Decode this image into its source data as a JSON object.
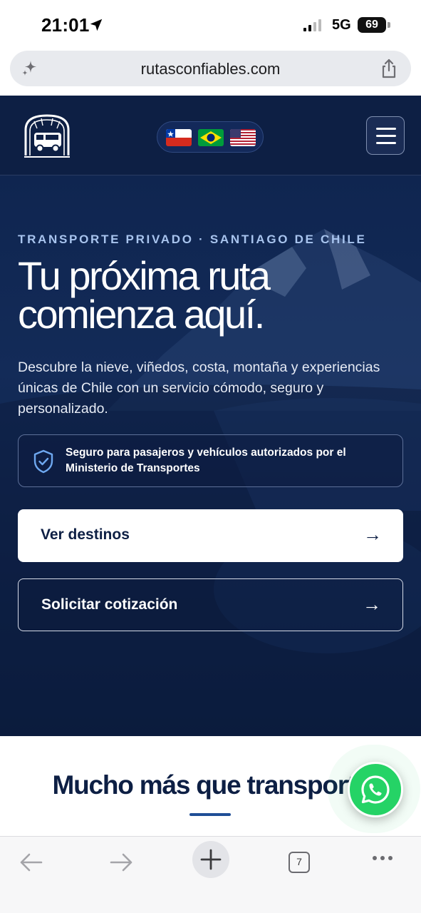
{
  "status_bar": {
    "time": "21:01",
    "network": "5G",
    "battery": "69"
  },
  "browser": {
    "url": "rutasconfiables.com",
    "tab_count": "7"
  },
  "header": {
    "languages": [
      "Español (Chile)",
      "Português (Brasil)",
      "English (USA)"
    ]
  },
  "hero": {
    "eyebrow": "TRANSPORTE PRIVADO · SANTIAGO DE CHILE",
    "headline_line1": "Tu próxima ruta",
    "headline_line2": "comienza aquí.",
    "intro": "Descubre la nieve, viñedos, costa, montaña y experiencias únicas de Chile con un servicio cómodo, seguro y personalizado.",
    "safety_notice": "Seguro para pasajeros y vehículos autorizados por el Ministerio de Transportes",
    "cta_primary": "Ver destinos",
    "cta_secondary": "Solicitar cotización",
    "arrow": "→"
  },
  "section": {
    "title": "Mucho más que transporte"
  },
  "colors": {
    "navy": "#0d1f44",
    "hero_accent": "#a8c4ee",
    "whatsapp_green": "#25d366",
    "underline_blue": "#1f4e96"
  }
}
